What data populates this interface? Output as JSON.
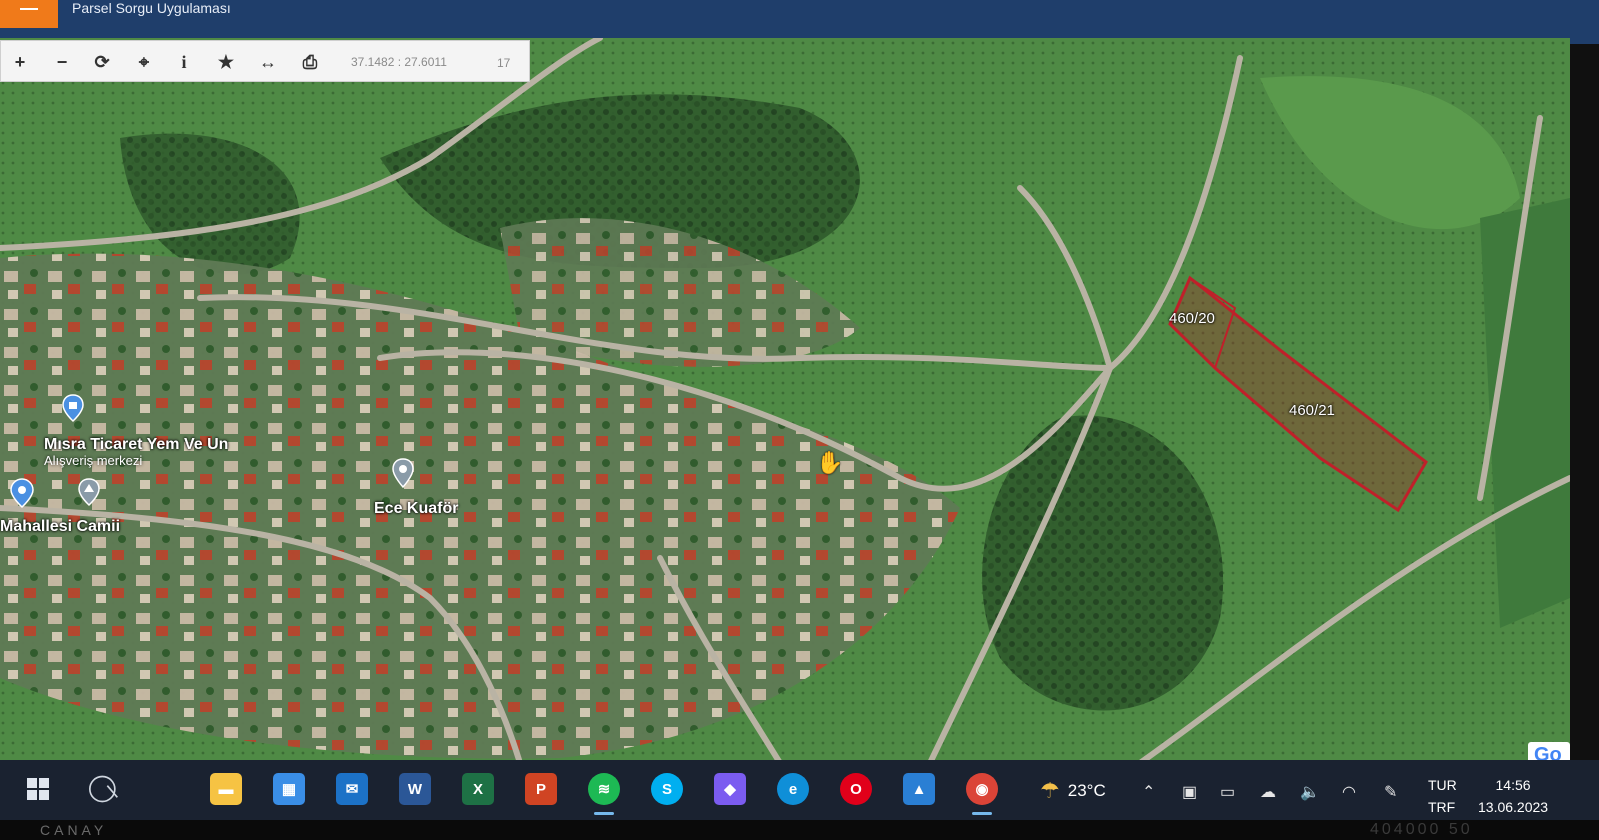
{
  "app": {
    "title": "Parsel Sorgu Uygulaması"
  },
  "toolbar": {
    "tools": [
      {
        "name": "zoom-in",
        "glyph": "+"
      },
      {
        "name": "zoom-out",
        "glyph": "−"
      },
      {
        "name": "refresh",
        "glyph": "⟳"
      },
      {
        "name": "locate",
        "glyph": "⌖"
      },
      {
        "name": "info",
        "glyph": "i"
      },
      {
        "name": "favorite",
        "glyph": "★"
      },
      {
        "name": "measure",
        "glyph": "↔"
      },
      {
        "name": "print",
        "glyph": "⎙"
      }
    ],
    "coordinates": "37.1482 : 27.6011",
    "zoom": "17"
  },
  "map": {
    "places": {
      "shop": "Mısra Ticaret Yem Ve Un",
      "shop_sub": "Alışveriş merkezi",
      "salon": "Ece Kuaför",
      "mosque": "Mahallesi Camii"
    },
    "parcels": [
      "460/20",
      "460/21"
    ],
    "parcel_color": "#c0202a",
    "attribution": "Go"
  },
  "taskbar": {
    "apps": [
      {
        "name": "file-explorer",
        "glyph": "▬",
        "color": "#f6c343"
      },
      {
        "name": "store",
        "glyph": "▦",
        "color": "#3a8ee6"
      },
      {
        "name": "mail",
        "glyph": "✉",
        "color": "#1c72c7"
      },
      {
        "name": "word",
        "glyph": "W",
        "color": "#2b5797"
      },
      {
        "name": "excel",
        "glyph": "X",
        "color": "#1e7145"
      },
      {
        "name": "powerpoint",
        "glyph": "P",
        "color": "#d04423"
      },
      {
        "name": "spotify",
        "glyph": "≋",
        "color": "#1db954"
      },
      {
        "name": "skype",
        "glyph": "S",
        "color": "#00aff0"
      },
      {
        "name": "copilot",
        "glyph": "◆",
        "color": "#7b5cf0"
      },
      {
        "name": "edge",
        "glyph": "e",
        "color": "#0f8fd8"
      },
      {
        "name": "opera",
        "glyph": "O",
        "color": "#e1001a"
      },
      {
        "name": "photos",
        "glyph": "▲",
        "color": "#2a7fd4"
      },
      {
        "name": "chrome",
        "glyph": "◉",
        "color": "#db4437"
      }
    ],
    "weather": "23°C",
    "lang_top": "TUR",
    "lang_bottom": "TRF",
    "time": "14:56",
    "date": "13.06.2023"
  },
  "bezel": {
    "brand": "CANAY",
    "number_fragment": "404000 50"
  }
}
